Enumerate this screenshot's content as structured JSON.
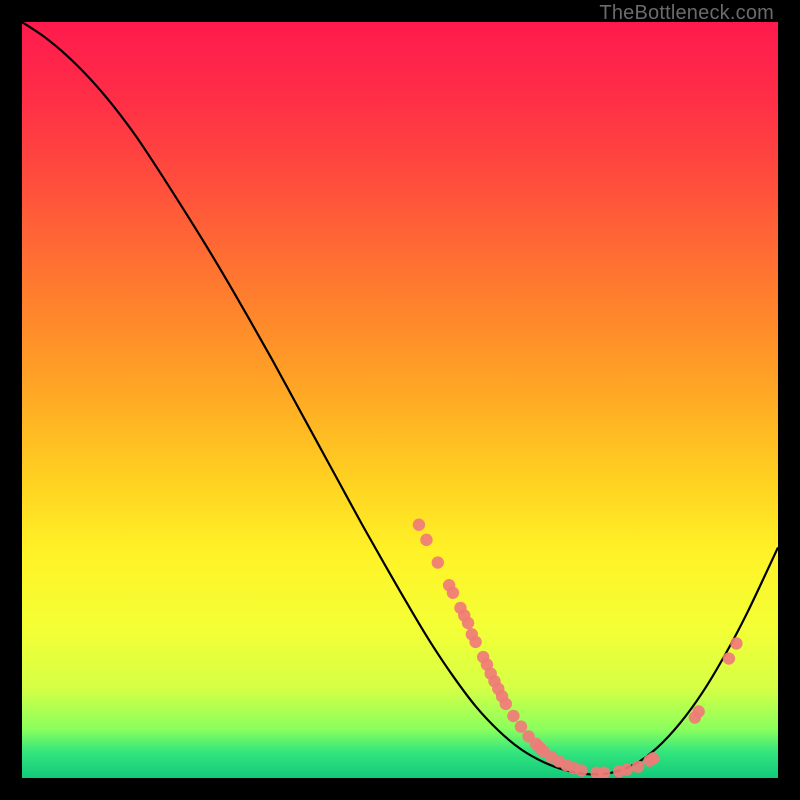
{
  "watermark": "TheBottleneck.com",
  "colors": {
    "bg": "#000000",
    "gradient_stops": [
      {
        "offset": 0.0,
        "color": "#ff1a4d"
      },
      {
        "offset": 0.1,
        "color": "#ff2e47"
      },
      {
        "offset": 0.2,
        "color": "#ff4a3e"
      },
      {
        "offset": 0.3,
        "color": "#ff6a34"
      },
      {
        "offset": 0.4,
        "color": "#ff8a2a"
      },
      {
        "offset": 0.5,
        "color": "#ffab24"
      },
      {
        "offset": 0.6,
        "color": "#ffcf21"
      },
      {
        "offset": 0.7,
        "color": "#fff227"
      },
      {
        "offset": 0.8,
        "color": "#f4ff35"
      },
      {
        "offset": 0.88,
        "color": "#d6ff45"
      },
      {
        "offset": 0.935,
        "color": "#8bff5c"
      },
      {
        "offset": 0.965,
        "color": "#35e67d"
      },
      {
        "offset": 1.0,
        "color": "#11c97a"
      }
    ],
    "curve": "#000000",
    "point_fill": "#f07b78",
    "point_stroke": "#f07b78"
  },
  "chart_data": {
    "type": "line",
    "title": "",
    "xlabel": "",
    "ylabel": "",
    "xlim": [
      0,
      100
    ],
    "ylim": [
      0,
      100
    ],
    "grid": false,
    "legend": false,
    "series": [
      {
        "name": "bottleneck-curve",
        "x": [
          0,
          3,
          6,
          9,
          12,
          15,
          18,
          21,
          24,
          27,
          30,
          33,
          36,
          39,
          42,
          45,
          48,
          51,
          54,
          57,
          60,
          63,
          66,
          69,
          72,
          75,
          78,
          81,
          84,
          87,
          90,
          93,
          96,
          100
        ],
        "y": [
          100,
          98,
          95.5,
          92.5,
          89,
          85,
          80.5,
          75.8,
          71,
          66,
          60.8,
          55.5,
          50,
          44.5,
          39,
          33.5,
          28.2,
          23,
          18,
          13.5,
          9.5,
          6.3,
          3.8,
          2.1,
          1.0,
          0.5,
          0.7,
          1.8,
          4.0,
          7.2,
          11.3,
          16.3,
          22.0,
          30.5
        ]
      }
    ],
    "scatter_points": [
      {
        "x": 52.5,
        "y": 33.5
      },
      {
        "x": 53.5,
        "y": 31.5
      },
      {
        "x": 55.0,
        "y": 28.5
      },
      {
        "x": 56.5,
        "y": 25.5
      },
      {
        "x": 57.0,
        "y": 24.5
      },
      {
        "x": 58.0,
        "y": 22.5
      },
      {
        "x": 58.5,
        "y": 21.5
      },
      {
        "x": 59.0,
        "y": 20.5
      },
      {
        "x": 59.5,
        "y": 19.0
      },
      {
        "x": 60.0,
        "y": 18.0
      },
      {
        "x": 61.0,
        "y": 16.0
      },
      {
        "x": 61.5,
        "y": 15.0
      },
      {
        "x": 62.0,
        "y": 13.8
      },
      {
        "x": 62.5,
        "y": 12.8
      },
      {
        "x": 63.0,
        "y": 11.8
      },
      {
        "x": 63.5,
        "y": 10.8
      },
      {
        "x": 64.0,
        "y": 9.8
      },
      {
        "x": 65.0,
        "y": 8.2
      },
      {
        "x": 66.0,
        "y": 6.8
      },
      {
        "x": 67.0,
        "y": 5.5
      },
      {
        "x": 68.0,
        "y": 4.5
      },
      {
        "x": 68.5,
        "y": 4.0
      },
      {
        "x": 69.0,
        "y": 3.5
      },
      {
        "x": 70.0,
        "y": 2.8
      },
      {
        "x": 71.0,
        "y": 2.2
      },
      {
        "x": 72.0,
        "y": 1.7
      },
      {
        "x": 73.0,
        "y": 1.3
      },
      {
        "x": 74.0,
        "y": 1.0
      },
      {
        "x": 76.0,
        "y": 0.7
      },
      {
        "x": 77.0,
        "y": 0.7
      },
      {
        "x": 79.0,
        "y": 0.9
      },
      {
        "x": 80.0,
        "y": 1.1
      },
      {
        "x": 81.5,
        "y": 1.5
      },
      {
        "x": 83.0,
        "y": 2.3
      },
      {
        "x": 83.5,
        "y": 2.6
      },
      {
        "x": 89.0,
        "y": 8.0
      },
      {
        "x": 89.5,
        "y": 8.8
      },
      {
        "x": 93.5,
        "y": 15.8
      },
      {
        "x": 94.5,
        "y": 17.8
      }
    ]
  }
}
